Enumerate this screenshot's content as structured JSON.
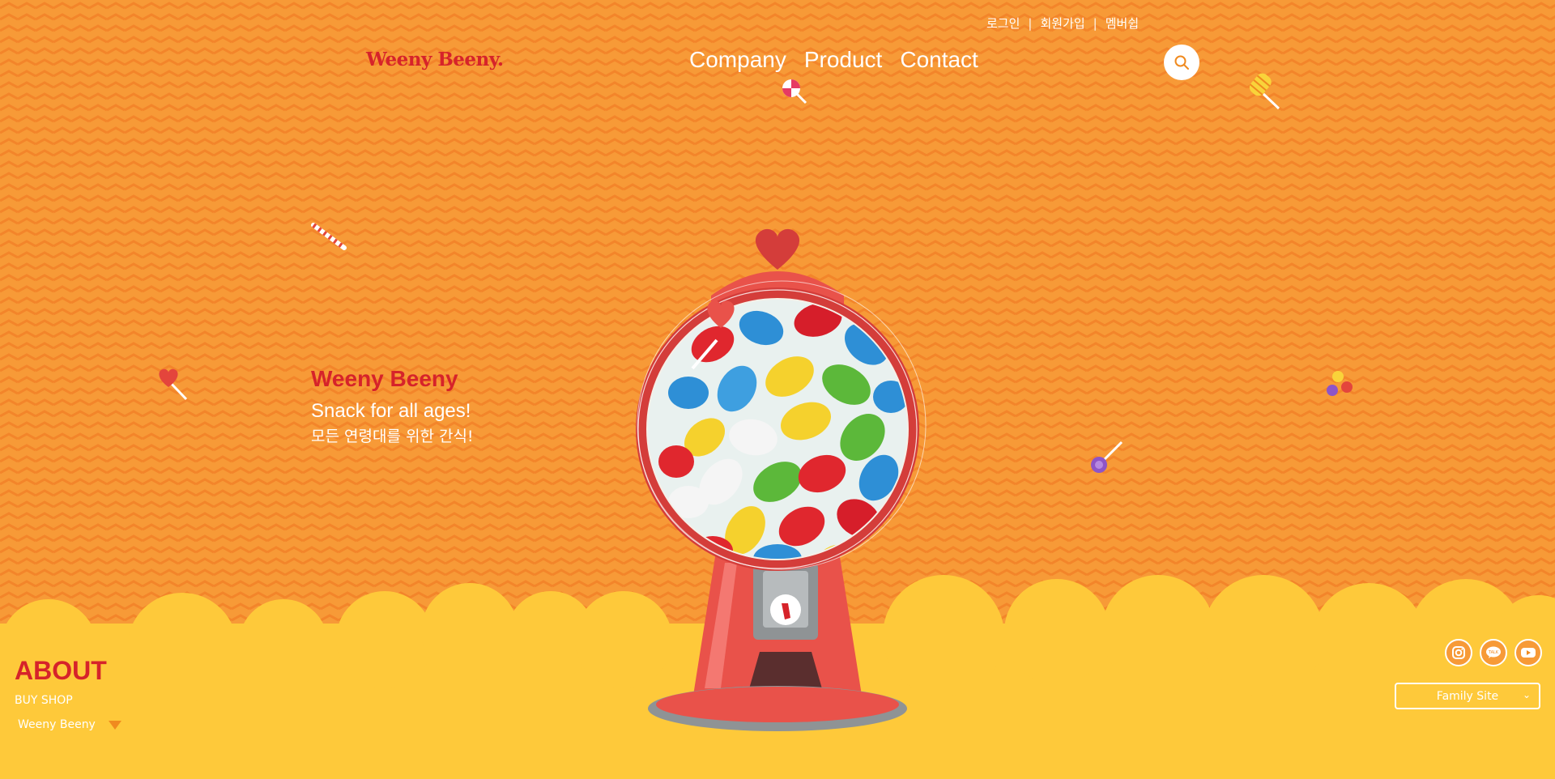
{
  "colors": {
    "background": "#f79a37",
    "ground": "#fec93a",
    "brand_red": "#d6232a",
    "text_white": "#ffffff"
  },
  "util_nav": {
    "login": "로그인",
    "join": "회원가입",
    "membership": "멤버쉽",
    "separator": "|"
  },
  "logo": {
    "text": "Weeny Beeny."
  },
  "main_nav": {
    "items": [
      {
        "label": "Company"
      },
      {
        "label": "Product"
      },
      {
        "label": "Contact"
      }
    ]
  },
  "search": {
    "icon": "search-icon"
  },
  "hero": {
    "title": "Weeny Beeny",
    "subtitle": "Snack for all ages!",
    "subtitle_ko": "모든 연령대를 위한 간식!"
  },
  "about": {
    "title": "ABOUT",
    "link": "BUY SHOP",
    "selected": "Weeny Beeny"
  },
  "social": {
    "icons": [
      "instagram-icon",
      "kakaotalk-icon",
      "youtube-icon"
    ],
    "kakao_label": "TALK"
  },
  "family_site": {
    "label": "Family Site"
  },
  "illustration": {
    "name": "gumball-machine"
  }
}
